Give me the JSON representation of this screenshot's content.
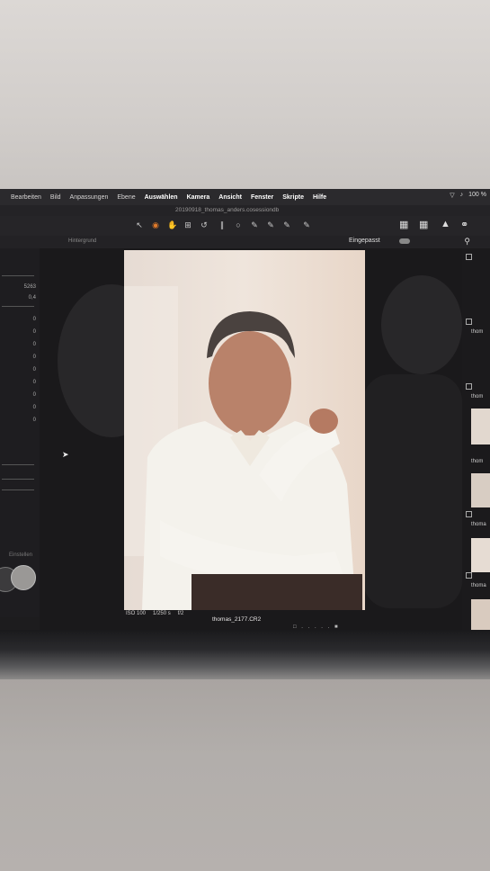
{
  "menubar": {
    "items": [
      "Bearbeiten",
      "Bild",
      "Anpassungen",
      "Ebene",
      "Auswählen",
      "Kamera",
      "Ansicht",
      "Fenster",
      "Skripte",
      "Hilfe"
    ],
    "status_text": "100 %"
  },
  "document": {
    "title": "20190918_thomas_anders.cosessiondb"
  },
  "viewbar": {
    "fit_label": "Eingepasst",
    "layer_label": "Hintergrund"
  },
  "left_panel": {
    "values": [
      "5263",
      "0,4",
      "0",
      "0",
      "0",
      "0",
      "0",
      "0",
      "0",
      "0",
      "0"
    ],
    "label": "Einstellen"
  },
  "photo": {
    "iso": "ISO 100",
    "shutter": "1/250 s",
    "aperture": "f/2",
    "filename": "thomas_2177.CR2"
  },
  "thumbnails": [
    {
      "label": "thom"
    },
    {
      "label": "thom"
    },
    {
      "label": "thom"
    },
    {
      "label": "thoma"
    },
    {
      "label": "thoma"
    },
    {
      "label": "thoma"
    }
  ],
  "colors": {
    "screen_bg": "#1d1c1e",
    "photo_bg": "#ece1d8",
    "suit": "#f3f1ec"
  }
}
